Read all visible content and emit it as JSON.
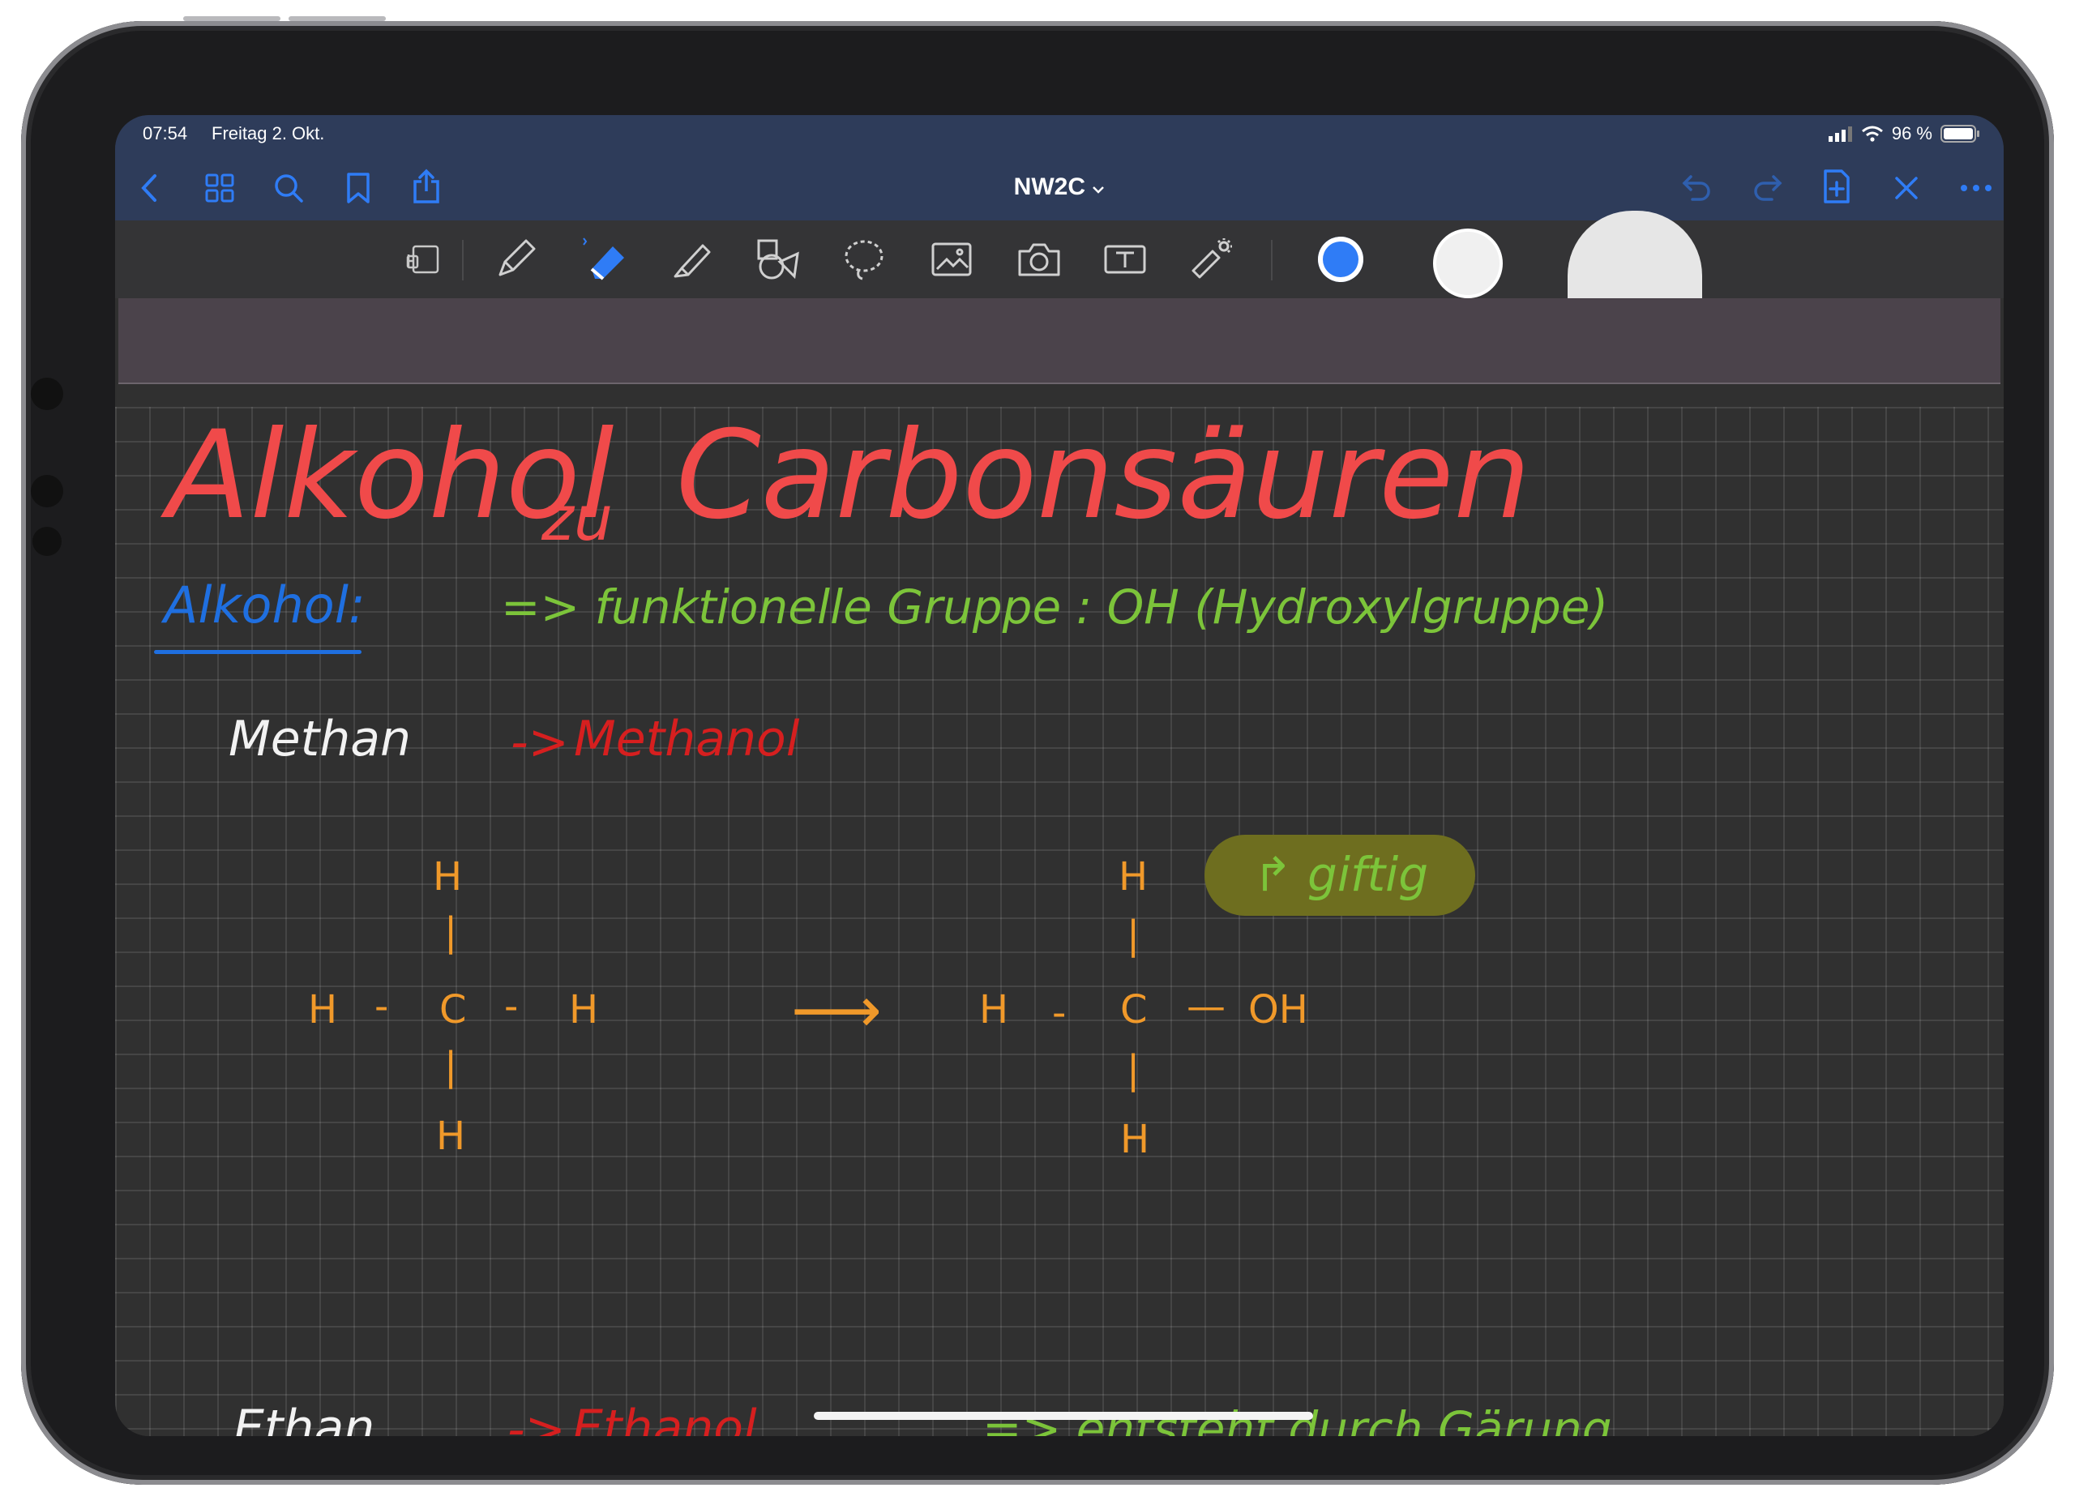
{
  "status": {
    "time": "07:54",
    "date": "Freitag 2. Okt.",
    "battery": "96 %"
  },
  "nav": {
    "title": "NW2C",
    "left_icons": [
      "back-icon",
      "grid-icon",
      "search-icon",
      "bookmark-icon",
      "share-icon"
    ],
    "right_icons": [
      "undo-icon",
      "redo-icon",
      "add-page-icon",
      "close-icon",
      "more-icon"
    ]
  },
  "toolbar": {
    "tools": [
      "read-only-icon",
      "pen-icon",
      "eraser-icon",
      "highlighter-icon",
      "shapes-icon",
      "lasso-icon",
      "image-icon",
      "camera-icon",
      "text-icon",
      "laser-pointer-icon"
    ],
    "active_tool": "eraser-icon",
    "accent_color": "#2f7cf6"
  },
  "note": {
    "title_main": "Alkohol",
    "title_mid": "zu",
    "title_end": "Carbonsäuren",
    "section": "Alkohol:",
    "def": "=> funktionelle Gruppe : OH (Hydroxylgruppe)",
    "row1_left": "Methan",
    "row1_arrow": "->",
    "row1_right": "Methanol",
    "highlight": "↱ giftig",
    "row2_left": "Ethan",
    "row2_arrow": "->",
    "row2_right": "Ethanol",
    "row2_note": "=> entsteht durch Gärung",
    "structure1": {
      "top": "H",
      "bond_top": "|",
      "left": "H",
      "dash1": "-",
      "center": "C",
      "dash2": "-",
      "right": "H",
      "bond_bottom": "|",
      "bottom": "H"
    },
    "reaction_arrow": "⟶",
    "structure2": {
      "top": "H",
      "bond_top": "|",
      "left": "H",
      "dash1": "-",
      "center": "C",
      "dash2": "—",
      "right": "OH",
      "bond_bottom": "|",
      "bottom": "H"
    }
  }
}
